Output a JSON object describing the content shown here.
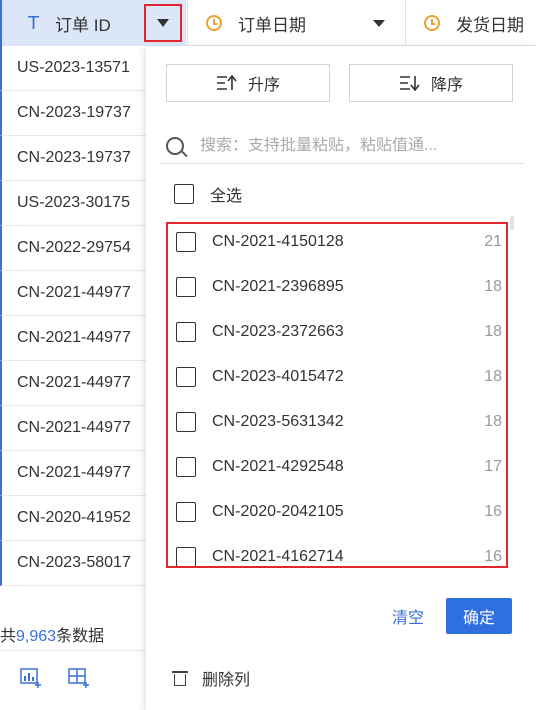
{
  "header": {
    "col_order_id": "订单 ID",
    "col_order_date": "订单日期",
    "col_ship_date": "发货日期"
  },
  "rows": [
    "US-2023-13571",
    "CN-2023-19737",
    "CN-2023-19737",
    "US-2023-30175",
    "CN-2022-29754",
    "CN-2021-44977",
    "CN-2021-44977",
    "CN-2021-44977",
    "CN-2021-44977",
    "CN-2021-44977",
    "CN-2020-41952",
    "CN-2023-58017"
  ],
  "footer": {
    "prefix": "共",
    "count": "9,963",
    "suffix": "条数据"
  },
  "panel": {
    "sort_asc": "升序",
    "sort_desc": "降序",
    "search_placeholder": "搜索：支持批量粘贴，粘贴值通...",
    "select_all": "全选",
    "items": [
      {
        "label": "CN-2021-4150128",
        "count": "21"
      },
      {
        "label": "CN-2021-2396895",
        "count": "18"
      },
      {
        "label": "CN-2023-2372663",
        "count": "18"
      },
      {
        "label": "CN-2023-4015472",
        "count": "18"
      },
      {
        "label": "CN-2023-5631342",
        "count": "18"
      },
      {
        "label": "CN-2021-4292548",
        "count": "17"
      },
      {
        "label": "CN-2020-2042105",
        "count": "16"
      },
      {
        "label": "CN-2021-4162714",
        "count": "16"
      }
    ],
    "clear_label": "清空",
    "ok_label": "确定",
    "delete_label": "删除列"
  },
  "colors": {
    "accent": "#2f6fe0",
    "highlight_border": "#e3262d",
    "date_icon": "#f0a030"
  },
  "icons": [
    "text-type-icon",
    "dropdown-arrow-icon",
    "clock-icon",
    "sort-asc-icon",
    "sort-desc-icon",
    "search-icon",
    "checkbox-icon",
    "trash-icon",
    "add-chart-icon",
    "add-table-icon"
  ]
}
